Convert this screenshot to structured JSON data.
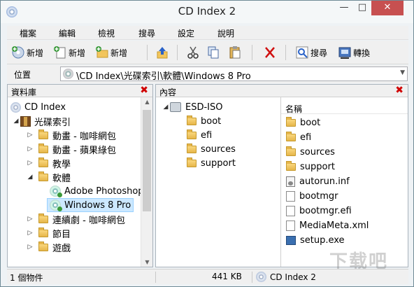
{
  "window": {
    "title": "CD Index 2"
  },
  "menu": [
    "檔案",
    "編輯",
    "檢視",
    "搜尋",
    "設定",
    "說明"
  ],
  "toolbar": {
    "add1": "新增",
    "add2": "新增",
    "add3": "新增",
    "search": "搜尋",
    "convert": "轉換"
  },
  "address": {
    "label": "位置",
    "value": "\\CD Index\\光碟索引\\軟體\\Windows 8 Pro"
  },
  "left_panel": {
    "title": "資料庫",
    "root": "CD Index",
    "group": "光碟索引",
    "items": [
      "動畫 - 咖啡網包",
      "動畫 - 蘋果綠包",
      "教學",
      "軟體"
    ],
    "software_children": [
      "Adobe Photoshop",
      "Windows 8 Pro"
    ],
    "items_after": [
      "連續劇 - 咖啡網包",
      "節目",
      "遊戲"
    ]
  },
  "right_panel": {
    "title": "內容",
    "disc_label": "ESD-ISO",
    "folders": [
      "boot",
      "efi",
      "sources",
      "support"
    ],
    "column_name": "名稱",
    "files": [
      "boot",
      "efi",
      "sources",
      "support",
      "autorun.inf",
      "bootmgr",
      "bootmgr.efi",
      "MediaMeta.xml",
      "setup.exe"
    ]
  },
  "status": {
    "count": "1 個物件",
    "size": "441 KB",
    "db": "CD Index 2"
  },
  "colors": {
    "accent": "#cce8ff",
    "close": "#c75050",
    "panel_close": "#d00000"
  },
  "watermark": "下载吧"
}
